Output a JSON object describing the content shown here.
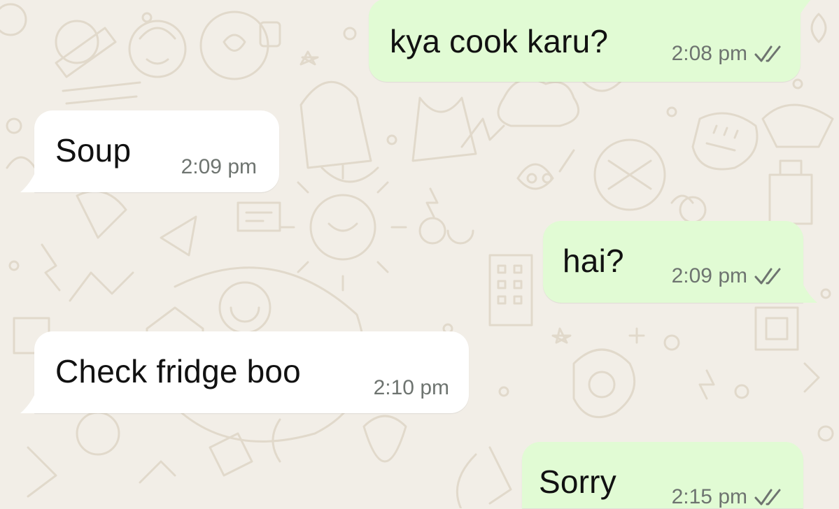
{
  "colors": {
    "wallpaper": "#f2eee7",
    "doodle": "#e1d9cb",
    "incoming_bubble": "#ffffff",
    "outgoing_bubble": "#e1fbd4",
    "message_text": "#111111",
    "timestamp": "#6e7470",
    "ticks": "#6e7470"
  },
  "chat": {
    "messages": [
      {
        "direction": "outgoing",
        "text": "kya cook karu?",
        "time": "2:08 pm",
        "status_icon": "double-check-icon"
      },
      {
        "direction": "incoming",
        "text": "Soup",
        "time": "2:09 pm"
      },
      {
        "direction": "outgoing",
        "text": "hai?",
        "time": "2:09 pm",
        "status_icon": "double-check-icon"
      },
      {
        "direction": "incoming",
        "text": "Check fridge boo",
        "time": "2:10 pm"
      },
      {
        "direction": "outgoing",
        "text": "Sorry",
        "time": "2:15 pm",
        "status_icon": "double-check-icon"
      }
    ]
  }
}
